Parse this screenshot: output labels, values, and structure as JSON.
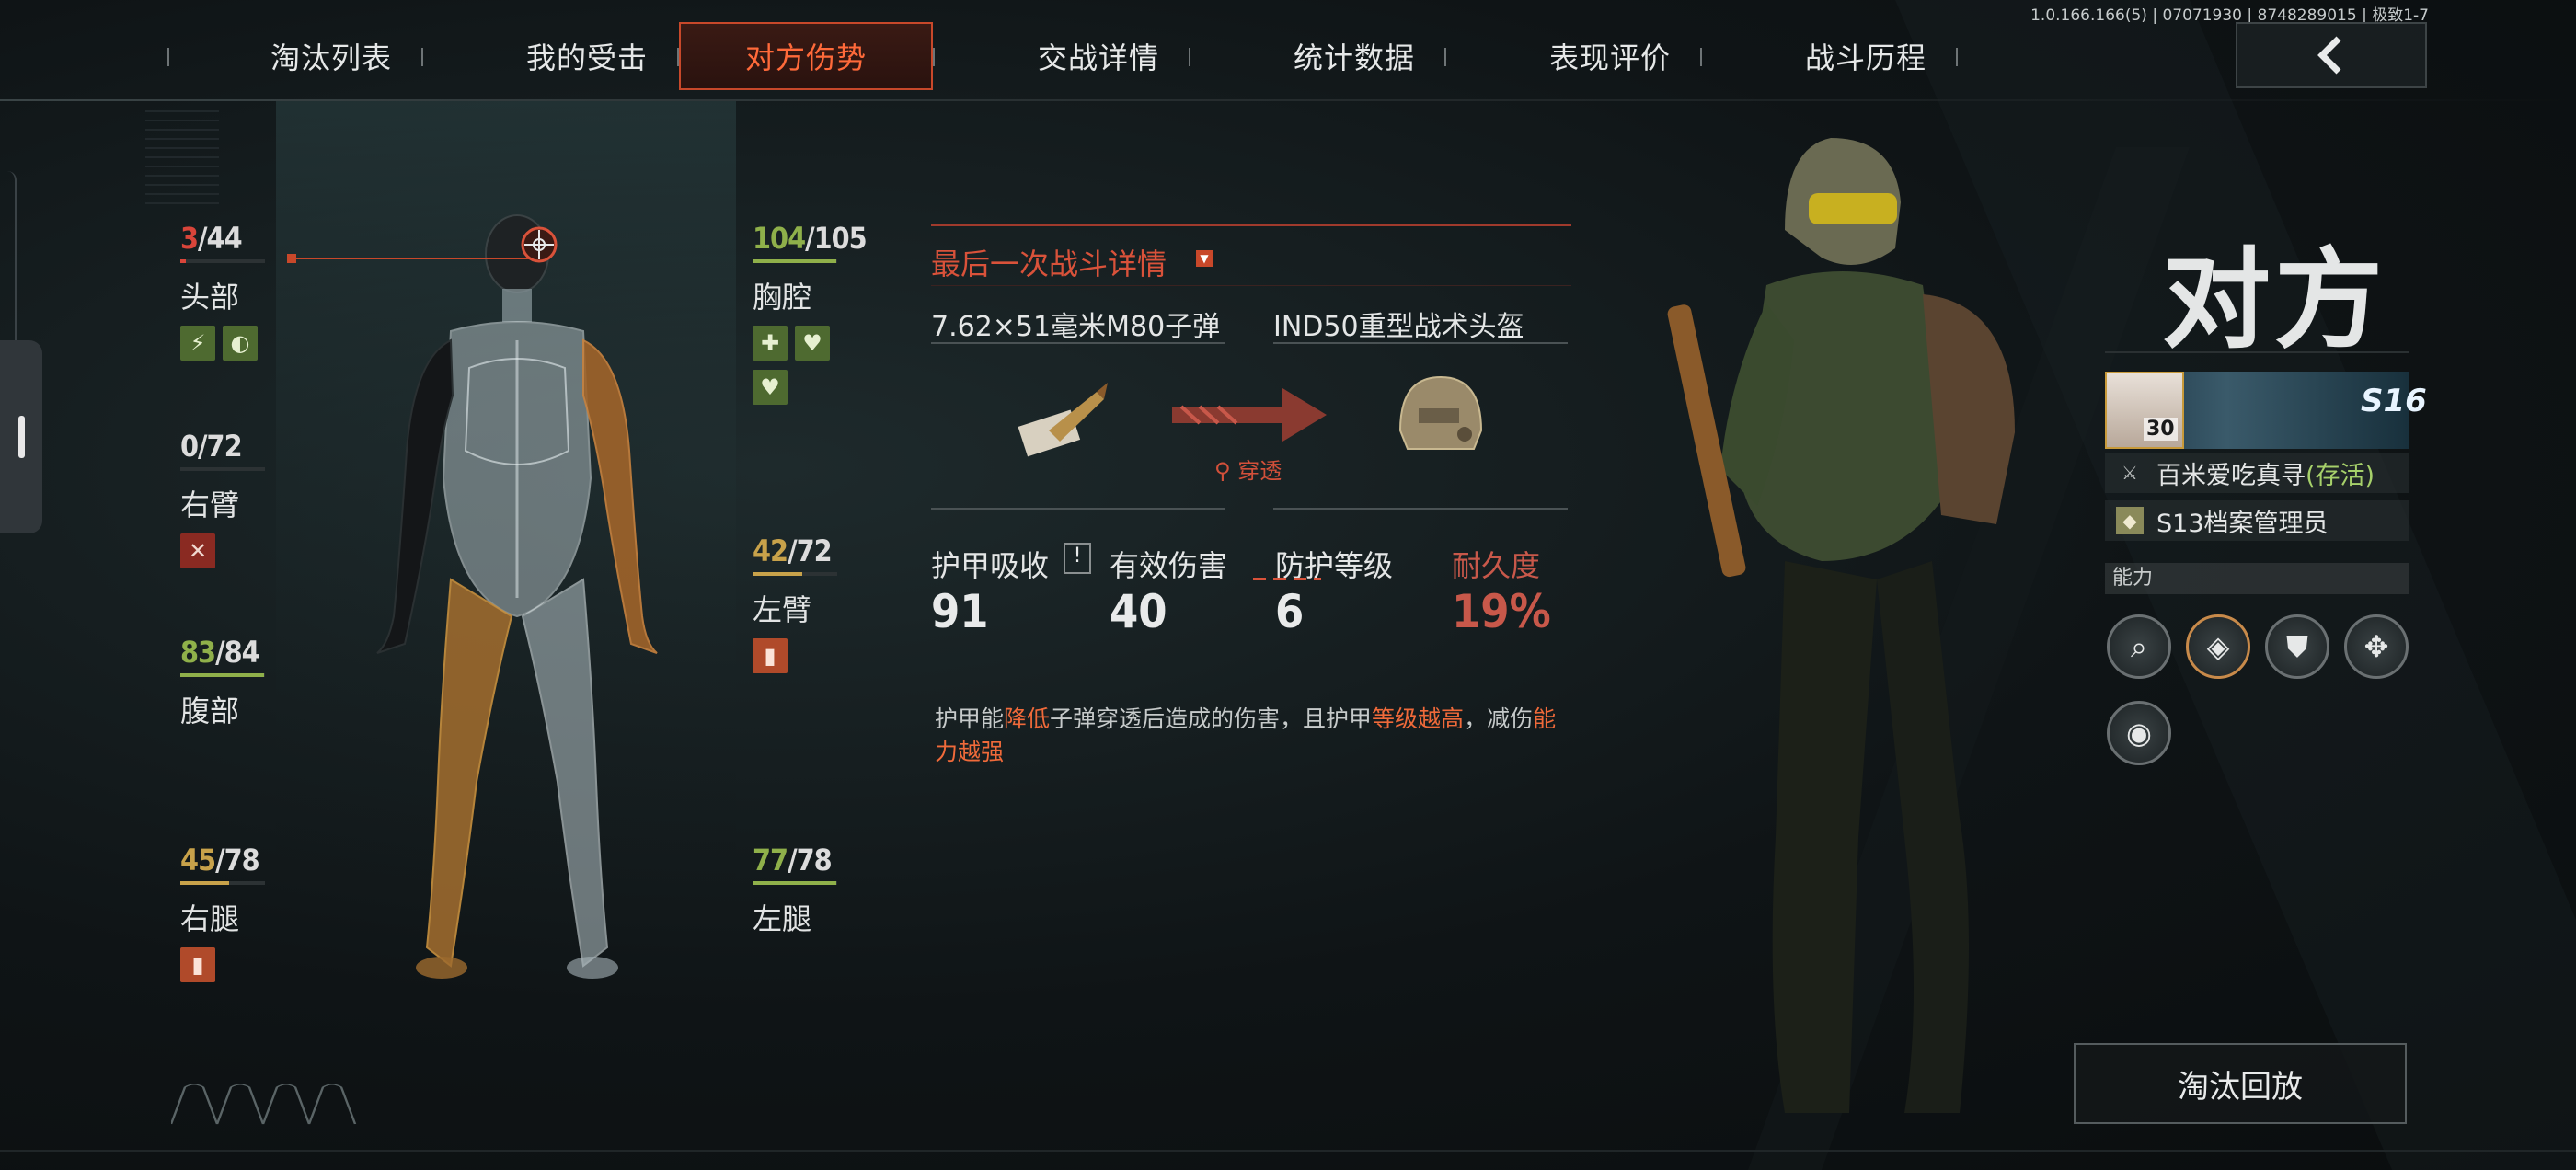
{
  "version": "1.0.166.166(5) | 07071930 | 8748289015 | 极致1-7",
  "nav": {
    "tabs": [
      {
        "label": "淘汰列表",
        "active": false
      },
      {
        "label": "我的受击",
        "active": false
      },
      {
        "label": "对方伤势",
        "active": true
      },
      {
        "label": "交战详情",
        "active": false
      },
      {
        "label": "统计数据",
        "active": false
      },
      {
        "label": "表现评价",
        "active": false
      },
      {
        "label": "战斗历程",
        "active": false
      }
    ],
    "back_icon": "chevron-left-icon"
  },
  "body_parts": {
    "head": {
      "current": "3",
      "max": "44",
      "name": "头部",
      "color": "#d9453a",
      "fraction": 0.068
    },
    "right_arm": {
      "current": "0",
      "max": "72",
      "name": "右臂",
      "color": "#dcdcdc",
      "fraction": 0.0
    },
    "abdomen": {
      "current": "83",
      "max": "84",
      "name": "腹部",
      "color": "#8fb04a",
      "fraction": 0.988
    },
    "right_leg": {
      "current": "45",
      "max": "78",
      "name": "右腿",
      "color": "#c8a24a",
      "fraction": 0.577
    },
    "chest": {
      "current": "104",
      "max": "105",
      "name": "胸腔",
      "color": "#8fb04a",
      "fraction": 0.99
    },
    "left_arm": {
      "current": "42",
      "max": "72",
      "name": "左臂",
      "color": "#c8a24a",
      "fraction": 0.583
    },
    "left_leg": {
      "current": "77",
      "max": "78",
      "name": "左腿",
      "color": "#8fb04a",
      "fraction": 0.987
    }
  },
  "battle": {
    "title": "最后一次战斗详情",
    "ammo": "7.62×51毫米M80子弹",
    "armor": "IND50重型战术头盔",
    "penetrate": "穿透",
    "stats": {
      "absorb_label": "护甲吸收",
      "absorb_value": "91",
      "damage_label": "有效伤害",
      "damage_value": "40",
      "level_label": "防护等级",
      "level_value": "6",
      "durability_label": "耐久度",
      "durability_value": "19%"
    },
    "note_parts": [
      "护甲能",
      "降低",
      "子弹穿透后造成的伤害，且护甲",
      "等级越高",
      "，减伤",
      "能力越强"
    ]
  },
  "opponent": {
    "title": "对方",
    "level": "30",
    "season": "S16",
    "name": "百米爱吃真寻",
    "status": "(存活)",
    "rank": "S13档案管理员",
    "ability_label": "能力"
  },
  "elim_replay": "淘汰回放",
  "colors": {
    "accent": "#d9523a",
    "healthy": "#8fb04a",
    "warning": "#c8a24a",
    "critical": "#d9453a"
  }
}
